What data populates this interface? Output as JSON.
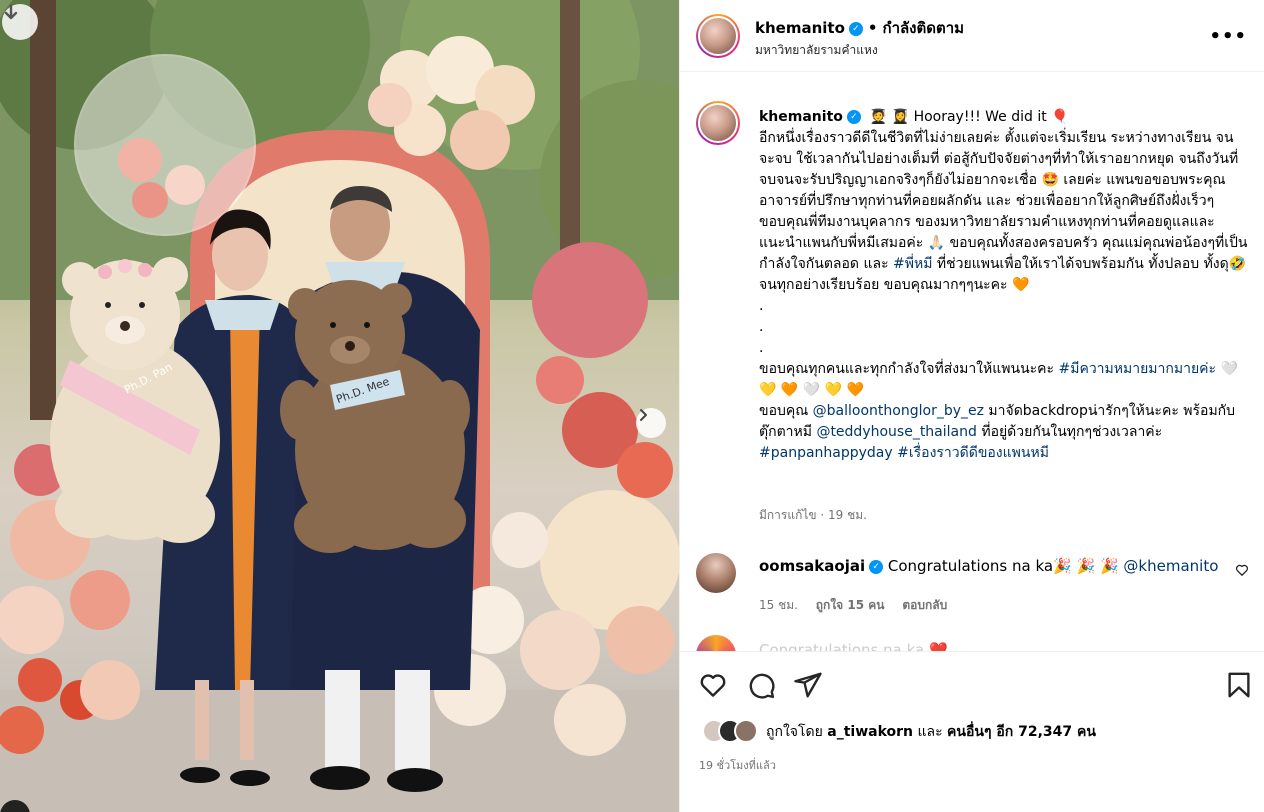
{
  "header": {
    "username": "khemanito",
    "follow_label": "กำลังติดตาม",
    "location": "มหาวิทยาลัยรามคำแหง",
    "more_label": "•••"
  },
  "photo": {
    "sash_left_text": "Ph.D. Pan",
    "tag_right_text": "Ph.D. Mee"
  },
  "caption": {
    "username": "khemanito",
    "intro": "Hooray!!! We did it 🎈",
    "body_1": "อีกหนึ่งเรื่องราวดีดีในชีวิตที่ไม่ง่ายเลยค่ะ ตั้งแต่จะเริ่มเรียน ระหว่างทางเรียน จนจะจบ ใช้เวลากันไปอย่างเต็มที่ ต่อสู้กับปัจจัยต่างๆที่ทำให้เราอยากหยุด จนถึงวันที่จบจนจะรับปริญญาเอกจริงๆก็ยังไม่อยากจะเชื่อ 🤩 เลยค่ะ แพนขอขอบพระคุณอาจารย์ที่ปรึกษาทุกท่านที่คอยผลักดัน และ ช่วยเพื่ออยากให้ลูกศิษย์ถึงฝั่งเร็วๆ ขอบคุณพี่ทีมงานบุคลากร ของมหาวิทยาลัยรามคำแหงทุกท่านที่คอยดูแลและแนะนำแพนกับพี่หมีเสมอค่ะ 🙏🏻 ขอบคุณทั้งสองครอบครัว คุณแม่คุณพ่อน้องๆที่เป็นกำลังใจกันตลอด และ ",
    "hashtag_1": "#พี่หมี",
    "body_2": " ที่ช่วยแพนเพื่อให้เราได้จบพร้อมกัน ทั้งปลอบ ทั้งดุ🤣 จนทุกอย่างเรียบร้อย ขอบคุณมากๆๆนะคะ 🧡",
    "dots": ".",
    "body_3": "ขอบคุณทุกคนและทุกกำลังใจที่ส่งมาให้แพนนะคะ ",
    "hashtag_2": "#มีความหมายมากมายค่ะ",
    "hearts": " 🤍 💛 🧡 🤍 💛 🧡",
    "body_4": "ขอบคุณ ",
    "mention_1": "@balloonthonglor_by_ez",
    "body_5": " มาจัดbackdropน่ารักๆให้นะคะ พร้อมกับตุ๊กตาหมี ",
    "mention_2": "@teddyhouse_thailand",
    "body_6": " ที่อยู่ด้วยกันในทุกๆช่วงเวลาค่ะ ",
    "hashtag_3": "#panpanhappyday",
    "hashtag_4": "#เรื่องราวดีดีของแพนหมี",
    "edited": "มีการแก้ไข · 19 ชม."
  },
  "comment": {
    "username": "oomsakaojai",
    "text": "Congratulations na ka🎉 🎉 🎉 ",
    "mention": "@khemanito",
    "time": "15 ชม.",
    "likes": "ถูกใจ 15 คน",
    "reply": "ตอบกลับ"
  },
  "comment2": {
    "text": "Congratulations na ka ❤️"
  },
  "likes": {
    "prefix": "ถูกใจโดย ",
    "user": "a_tiwakorn",
    "middle": " และ ",
    "others": "คนอื่นๆ อีก 72,347 คน"
  },
  "timestamp": "19 ชั่วโมงที่แล้ว",
  "colors": {
    "link": "#00376b",
    "verified": "#0095f6",
    "muted": "#737373"
  }
}
